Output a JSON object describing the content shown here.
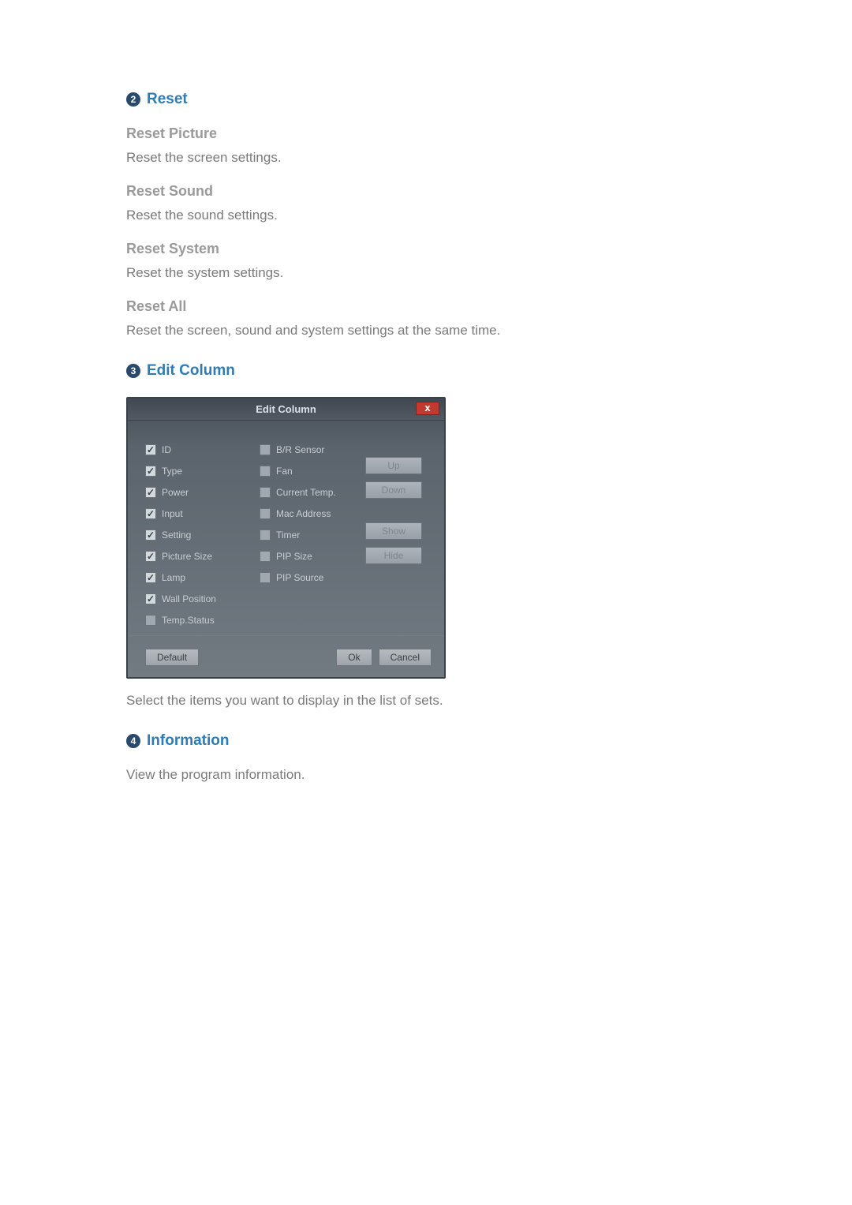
{
  "sections": {
    "reset": {
      "badge": "2",
      "title": "Reset",
      "items": [
        {
          "heading": "Reset Picture",
          "text": "Reset the screen settings."
        },
        {
          "heading": "Reset Sound",
          "text": "Reset the sound settings."
        },
        {
          "heading": "Reset System",
          "text": "Reset the system settings."
        },
        {
          "heading": "Reset All",
          "text": "Reset the screen, sound and system settings at the same time."
        }
      ]
    },
    "editColumn": {
      "badge": "3",
      "title": "Edit Column",
      "caption": "Select the items you want to display in the list of sets."
    },
    "information": {
      "badge": "4",
      "title": "Information",
      "text": "View the program information."
    }
  },
  "dialog": {
    "title": "Edit Column",
    "close": "x",
    "leftColumn": [
      {
        "label": "ID",
        "checked": true
      },
      {
        "label": "Type",
        "checked": true
      },
      {
        "label": "Power",
        "checked": true
      },
      {
        "label": "Input",
        "checked": true
      },
      {
        "label": "Setting",
        "checked": true
      },
      {
        "label": "Picture Size",
        "checked": true
      },
      {
        "label": "Lamp",
        "checked": true
      },
      {
        "label": "Wall Position",
        "checked": true
      },
      {
        "label": "Temp.Status",
        "checked": false
      }
    ],
    "midColumn": [
      {
        "label": "B/R Sensor",
        "checked": false
      },
      {
        "label": "Fan",
        "checked": false
      },
      {
        "label": "Current Temp.",
        "checked": false
      },
      {
        "label": "Mac Address",
        "checked": false
      },
      {
        "label": "Timer",
        "checked": false
      },
      {
        "label": "PIP Size",
        "checked": false
      },
      {
        "label": "PIP Source",
        "checked": false
      }
    ],
    "sideButtons": {
      "up": "Up",
      "down": "Down",
      "show": "Show",
      "hide": "Hide"
    },
    "footer": {
      "default": "Default",
      "ok": "Ok",
      "cancel": "Cancel"
    }
  }
}
